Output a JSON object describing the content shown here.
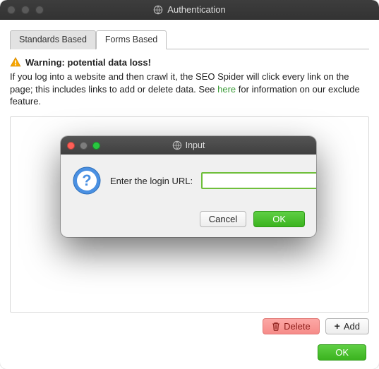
{
  "window": {
    "title": "Authentication"
  },
  "tabs": [
    {
      "label": "Standards Based"
    },
    {
      "label": "Forms Based"
    }
  ],
  "warning": {
    "heading": "Warning: potential data loss!",
    "body_pre": "If you log into a website and then crawl it, the SEO Spider will click every link on the page; this includes links to add or delete data. See ",
    "link": "here",
    "body_post": " for information on our exclude feature."
  },
  "buttons": {
    "delete": "Delete",
    "add": "Add",
    "ok": "OK"
  },
  "modal": {
    "title": "Input",
    "prompt": "Enter the login URL:",
    "value": "",
    "cancel": "Cancel",
    "ok": "OK"
  }
}
